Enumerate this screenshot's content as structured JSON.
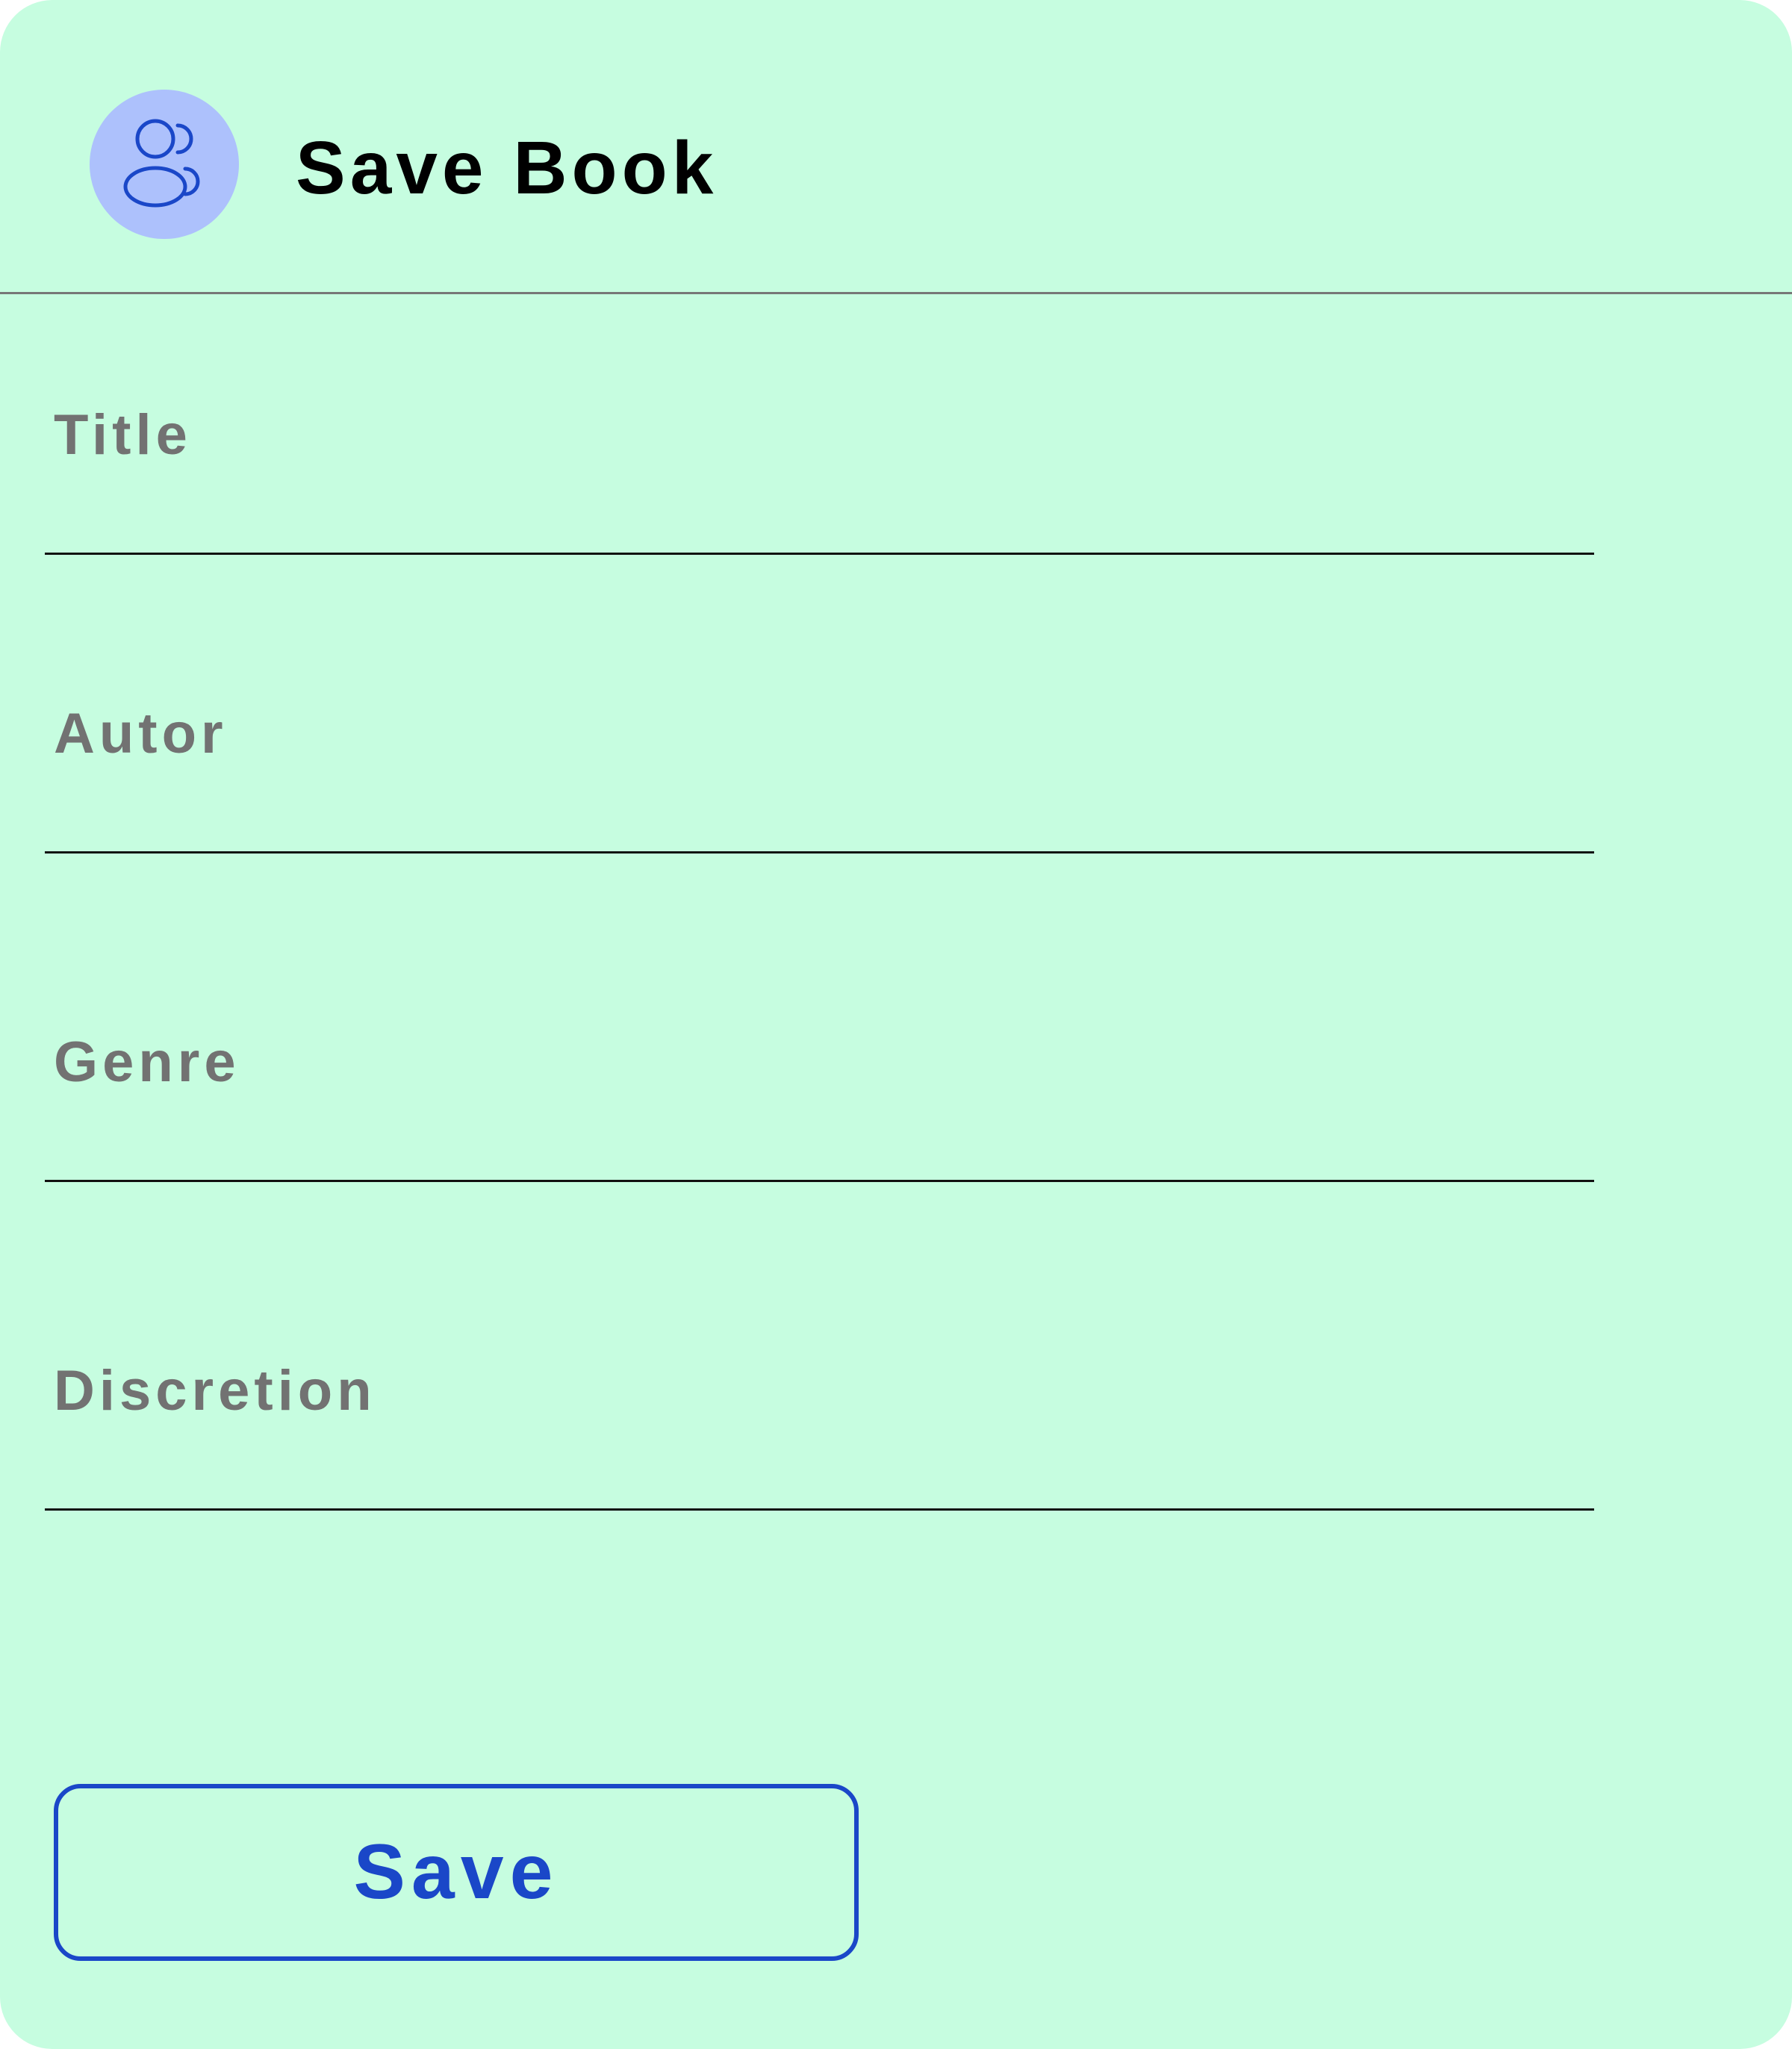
{
  "dialog": {
    "title": "Save Book",
    "icon": "users-icon",
    "icon_bg_color": "#adc1fc",
    "icon_color": "#1a47c8",
    "background_color": "#c6fde0"
  },
  "form": {
    "fields": [
      {
        "label": "Title",
        "value": ""
      },
      {
        "label": "Autor",
        "value": ""
      },
      {
        "label": "Genre",
        "value": ""
      },
      {
        "label": "Discretion",
        "value": ""
      }
    ]
  },
  "actions": {
    "save_label": "Save",
    "accent_color": "#1a47c8"
  }
}
